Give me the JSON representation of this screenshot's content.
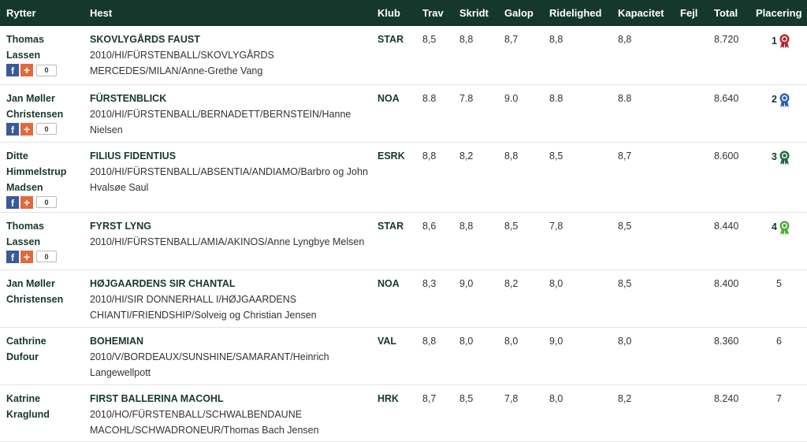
{
  "headers": {
    "rider": "Rytter",
    "horse": "Hest",
    "club": "Klub",
    "trav": "Trav",
    "skridt": "Skridt",
    "galop": "Galop",
    "ridelighed": "Ridelighed",
    "kapacitet": "Kapacitet",
    "fejl": "Fejl",
    "total": "Total",
    "placering": "Placering"
  },
  "rows": [
    {
      "rider_lines": [
        "Thomas",
        "Lassen"
      ],
      "horse_name": "SKOVLYGÅRDS FAUST",
      "horse_info": "2010/HI/FÜRSTENBALL/SKOVLYGÅRDS MERCEDES/MILAN/Anne-Grethe Vang",
      "club": "STAR",
      "trav": "8,5",
      "skridt": "8,8",
      "galop": "8,7",
      "ridelighed": "8,8",
      "kapacitet": "8,8",
      "fejl": "",
      "total": "8.720",
      "placering": "1",
      "share_count": "0",
      "rosette_icon": "rosette-red-icon",
      "rosette_color": "#b8222a"
    },
    {
      "rider_lines": [
        "Jan Møller",
        "Christensen"
      ],
      "horse_name": "FÜRSTENBLICK",
      "horse_info": "2010/HI/FÜRSTENBALL/BERNADETT/BERNSTEIN/Hanne Nielsen",
      "club": "NOA",
      "trav": "8.8",
      "skridt": "7.8",
      "galop": "9.0",
      "ridelighed": "8.8",
      "kapacitet": "8.8",
      "fejl": "",
      "total": "8.640",
      "placering": "2",
      "share_count": "0",
      "rosette_icon": "rosette-blue-icon",
      "rosette_color": "#2a5fae"
    },
    {
      "rider_lines": [
        "Ditte",
        "Himmelstrup",
        "Madsen"
      ],
      "horse_name": "FILIUS FIDENTIUS",
      "horse_info": "2010/HI/FÜRSTENBALL/ABSENTIA/ANDIAMO/Barbro og John Hvalsøe Saul",
      "club": "ESRK",
      "trav": "8,8",
      "skridt": "8,2",
      "galop": "8,8",
      "ridelighed": "8,5",
      "kapacitet": "8,7",
      "fejl": "",
      "total": "8.600",
      "placering": "3",
      "share_count": "0",
      "rosette_icon": "rosette-green-icon",
      "rosette_color": "#1e6a3c"
    },
    {
      "rider_lines": [
        "Thomas",
        "Lassen"
      ],
      "horse_name": "FYRST LYNG",
      "horse_info": "2010/HI/FÜRSTENBALL/AMIA/AKINOS/Anne Lyngbye Melsen",
      "club": "STAR",
      "trav": "8,6",
      "skridt": "8,8",
      "galop": "8,5",
      "ridelighed": "7,8",
      "kapacitet": "8,5",
      "fejl": "",
      "total": "8.440",
      "placering": "4",
      "share_count": "0",
      "rosette_icon": "rosette-lightgreen-icon",
      "rosette_color": "#4caa3a"
    },
    {
      "rider_lines": [
        "Jan Møller",
        "Christensen"
      ],
      "horse_name": "HØJGAARDENS SIR CHANTAL",
      "horse_info": "2010/HI/SIR DONNERHALL I/HØJGAARDENS CHIANTI/FRIENDSHIP/Solveig og Christian Jensen",
      "club": "NOA",
      "trav": "8,3",
      "skridt": "9,0",
      "galop": "8,2",
      "ridelighed": "8,0",
      "kapacitet": "8,5",
      "fejl": "",
      "total": "8.400",
      "placering": "5"
    },
    {
      "rider_lines": [
        "Cathrine",
        "Dufour"
      ],
      "horse_name": "BOHEMIAN",
      "horse_info": "2010/V/BORDEAUX/SUNSHINE/SAMARANT/Heinrich Langewellpott",
      "club": "VAL",
      "trav": "8,8",
      "skridt": "8,0",
      "galop": "8,0",
      "ridelighed": "9,0",
      "kapacitet": "8,0",
      "fejl": "",
      "total": "8.360",
      "placering": "6"
    },
    {
      "rider_lines": [
        "Katrine",
        "Kraglund"
      ],
      "horse_name": "FIRST BALLERINA MACOHL",
      "horse_info": "2010/HO/FÜRSTENBALL/SCHWALBENDAUNE MACOHL/SCHWADRONEUR/Thomas Bach Jensen",
      "club": "HRK",
      "trav": "8,7",
      "skridt": "8,5",
      "galop": "7,8",
      "ridelighed": "8,0",
      "kapacitet": "8,2",
      "fejl": "",
      "total": "8.240",
      "placering": "7"
    }
  ]
}
